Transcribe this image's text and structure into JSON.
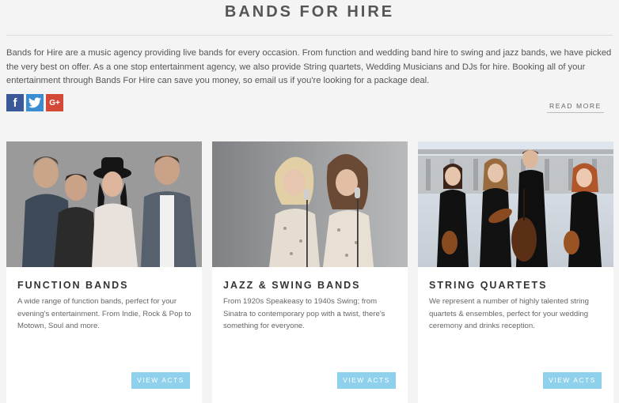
{
  "header": {
    "title": "BANDS FOR HIRE",
    "intro": "Bands for Hire are a music agency providing live bands for every occasion. From function and wedding band hire to swing and jazz bands, we have picked the very best on offer. As a one stop entertainment agency, we also provide String quartets, Wedding Musicians and DJs for hire. Booking all of your entertainment through Bands For Hire can save you money, so email us if you're looking for a package deal."
  },
  "social": {
    "facebook_glyph": "f",
    "google_glyph": "G+",
    "icons": [
      "facebook-icon",
      "twitter-icon",
      "google-plus-icon"
    ],
    "colors": {
      "facebook": "#3b5998",
      "twitter": "#3a8dd1",
      "google": "#d34836"
    }
  },
  "read_more": "READ MORE",
  "accent_color": "#8fd0ec",
  "cards": [
    {
      "heading": "FUNCTION BANDS",
      "description": "A wide range of function bands, perfect for your evening's entertainment. From Indie, Rock & Pop to Motown, Soul and more.",
      "button": "VIEW ACTS"
    },
    {
      "heading": "JAZZ & SWING BANDS",
      "description": "From 1920s Speakeasy to 1940s Swing; from Sinatra to contemporary pop with a twist, there's something for everyone.",
      "button": "VIEW ACTS"
    },
    {
      "heading": "STRING QUARTETS",
      "description": "We represent a number of highly talented string quartets & ensembles, perfect for your wedding ceremony and drinks reception.",
      "button": "VIEW ACTS"
    }
  ]
}
